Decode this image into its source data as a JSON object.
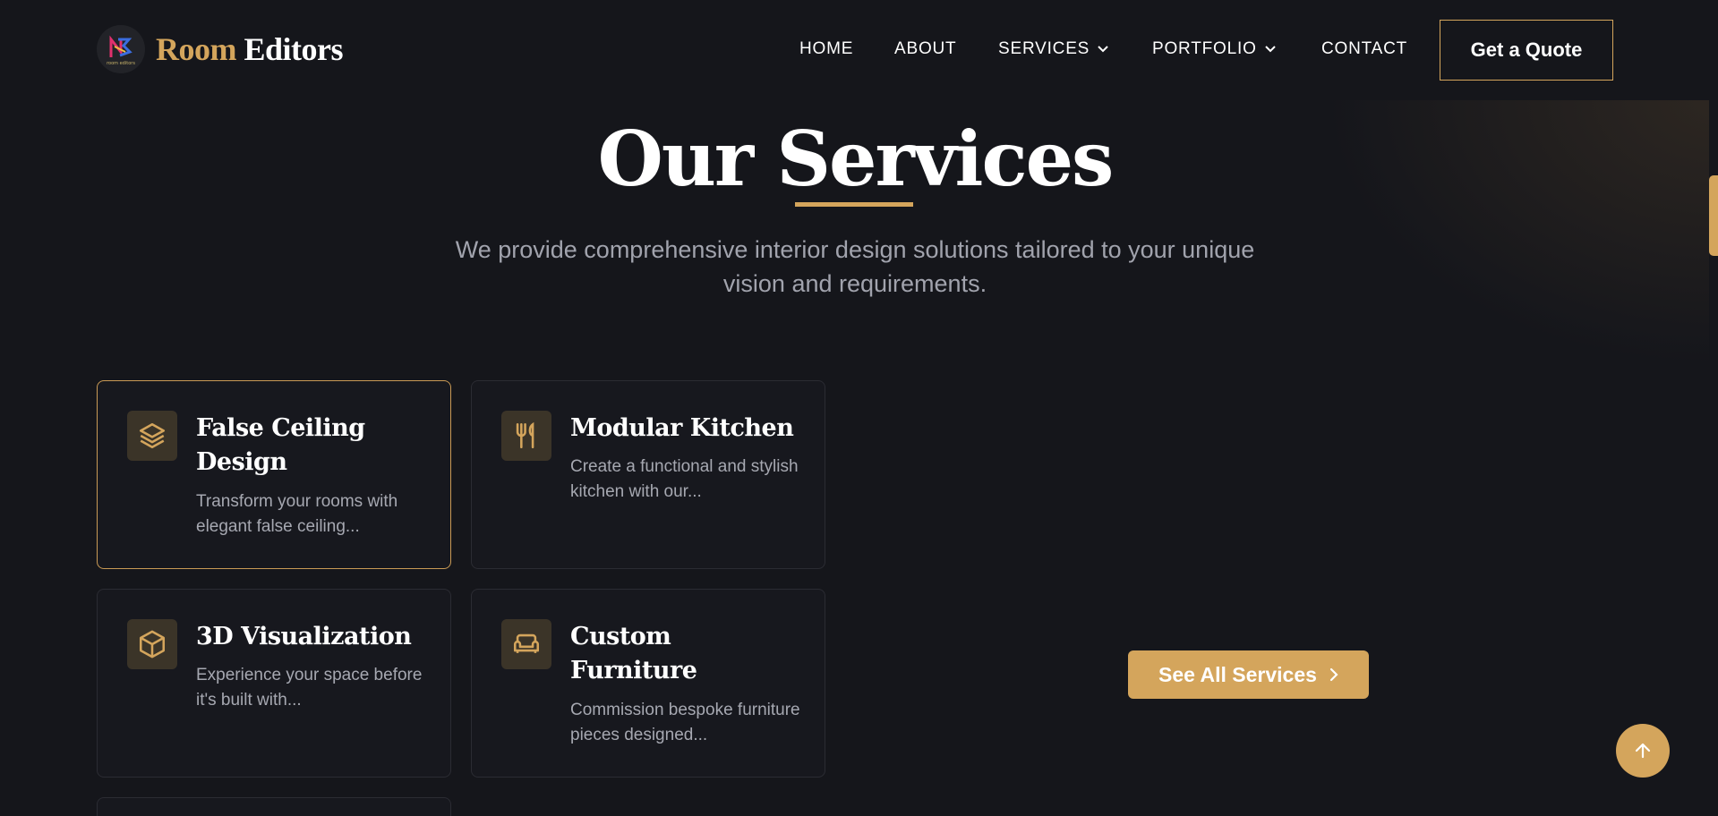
{
  "header": {
    "logo": {
      "word1": "Room",
      "word2": "Editors",
      "mark_text": "room editors"
    },
    "nav": [
      {
        "label": "HOME",
        "dropdown": false
      },
      {
        "label": "ABOUT",
        "dropdown": false
      },
      {
        "label": "SERVICES",
        "dropdown": true
      },
      {
        "label": "PORTFOLIO",
        "dropdown": true
      },
      {
        "label": "CONTACT",
        "dropdown": false
      }
    ],
    "cta_label": "Get a Quote"
  },
  "hero": {
    "title": "Our Services",
    "subtitle": "We provide comprehensive interior design solutions tailored to your unique vision and requirements."
  },
  "services": [
    {
      "title": "False Ceiling Design",
      "description": "Transform your rooms with elegant false ceiling...",
      "icon": "layers-icon",
      "active": true
    },
    {
      "title": "Modular Kitchen",
      "description": "Create a functional and stylish kitchen with our...",
      "icon": "utensils-icon",
      "active": false
    },
    {
      "title": "3D Visualization",
      "description": "Experience your space before it's built with...",
      "icon": "cube-icon",
      "active": false
    },
    {
      "title": "Custom Furniture",
      "description": "Commission bespoke furniture pieces designed...",
      "icon": "sofa-icon",
      "active": false
    }
  ],
  "see_all_label": "See All Services",
  "scroll_top_icon": "arrow-up-icon",
  "colors": {
    "background": "#15161b",
    "accent": "#d4a55c",
    "card_bg": "#17181e",
    "muted_text": "#a1a3ad"
  }
}
